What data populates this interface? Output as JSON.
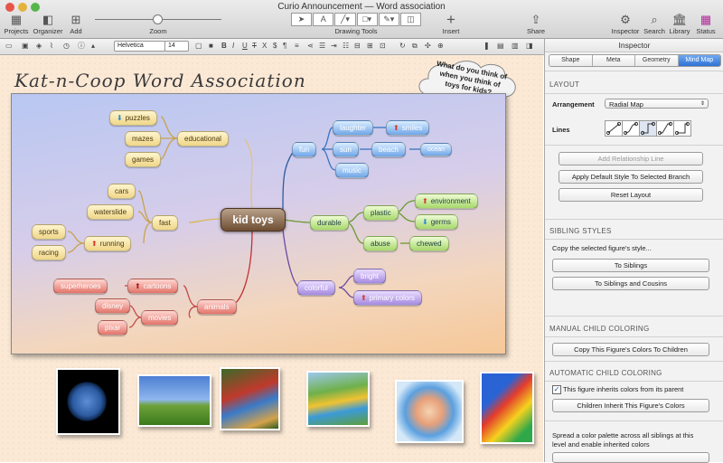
{
  "window": {
    "title": "Curio Announcement — Word association"
  },
  "toolbar": {
    "projects": "Projects",
    "organizer": "Organizer",
    "add": "Add",
    "zoom": "Zoom",
    "drawing_tools": "Drawing Tools",
    "insert": "Insert",
    "share": "Share",
    "inspector": "Inspector",
    "search": "Search",
    "library": "Library",
    "status": "Status"
  },
  "format": {
    "font": "Helvetica",
    "size": "14",
    "bold": "B",
    "italic": "I",
    "underline": "U",
    "strike": "T",
    "sup": "X",
    "dollar": "$",
    "para": "¶"
  },
  "canvas": {
    "heading": "Kat-n-Coop Word Association",
    "cloud_text": "What do you think of when you think of toys for kids?",
    "root": "kid toys",
    "nodes": {
      "puzzles": "puzzles",
      "mazes": "mazes",
      "games": "games",
      "educational": "educational",
      "cars": "cars",
      "waterslide": "waterslide",
      "fast": "fast",
      "sports": "sports",
      "racing": "racing",
      "running": "running",
      "superheroes": "superheroes",
      "cartoons": "cartoons",
      "disney": "disney",
      "pixar": "pixar",
      "movies": "movies",
      "animals": "animals",
      "fun": "fun",
      "laughter": "laughter",
      "smiles": "smiles",
      "sun": "sun",
      "beach": "beach",
      "ocean": "ocean",
      "music": "music",
      "durable": "durable",
      "plastic": "plastic",
      "environment": "environment",
      "germs": "germs",
      "abuse": "abuse",
      "chewed": "chewed",
      "colorful": "colorful",
      "bright": "bright",
      "primary_colors": "primary colors"
    }
  },
  "inspector": {
    "title": "Inspector",
    "tabs": [
      "Shape",
      "Meta",
      "Geometry",
      "Mind Map"
    ],
    "layout": "LAYOUT",
    "arrangement_label": "Arrangement",
    "arrangement_value": "Radial Map",
    "lines_label": "Lines",
    "add_relationship": "Add Relationship Line",
    "apply_default": "Apply Default Style To Selected Branch",
    "reset_layout": "Reset Layout",
    "sibling_styles": "SIBLING STYLES",
    "copy_style_text": "Copy the selected figure's style...",
    "to_siblings": "To Siblings",
    "to_siblings_cousins": "To Siblings and Cousins",
    "manual_child": "MANUAL CHILD COLORING",
    "copy_colors": "Copy This Figure's Colors To Children",
    "auto_child": "AUTOMATIC CHILD COLORING",
    "inherit_text": "This figure inherits colors from its parent",
    "children_inherit": "Children Inherit This Figure's Colors",
    "spread_text": "Spread a color palette across all siblings at this level and enable inherited colors"
  }
}
